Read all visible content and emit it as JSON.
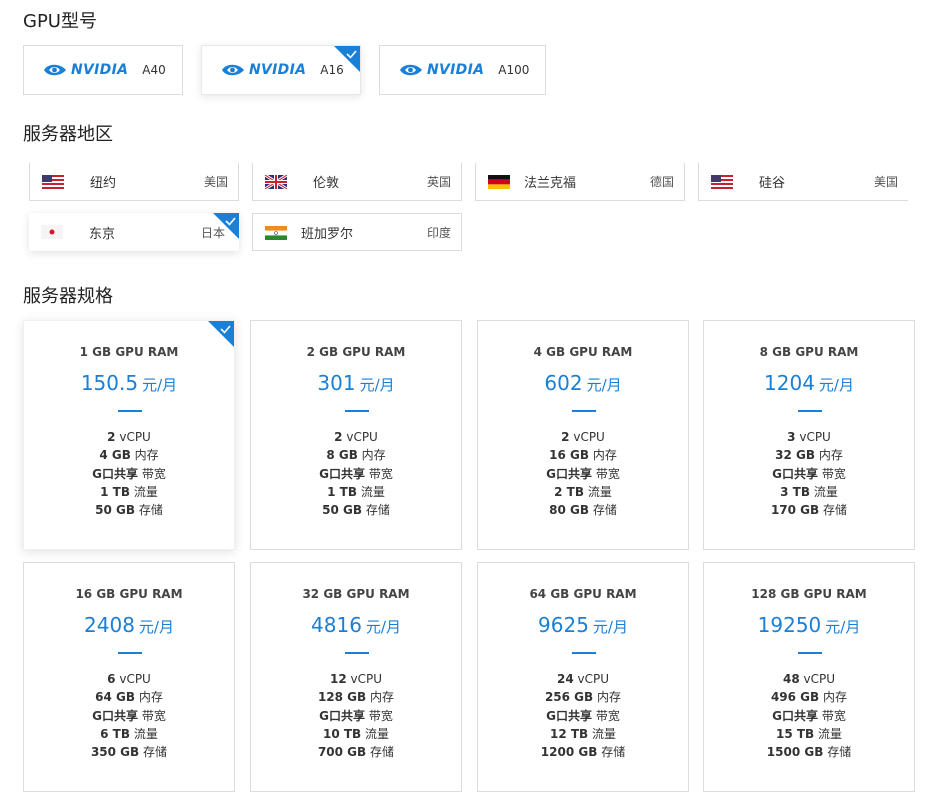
{
  "sections": {
    "gpu_title": "GPU型号",
    "region_title": "服务器地区",
    "spec_title": "服务器规格"
  },
  "brand": {
    "name": "NVIDIA",
    "color": "#1a7fd6"
  },
  "gpu_models": [
    {
      "model": "A40",
      "selected": false
    },
    {
      "model": "A16",
      "selected": true
    },
    {
      "model": "A100",
      "selected": false
    }
  ],
  "regions": [
    {
      "city": "纽约",
      "country": "美国",
      "flag": "us-flag-icon",
      "selected": false
    },
    {
      "city": "伦敦",
      "country": "英国",
      "flag": "uk-flag-icon",
      "selected": false
    },
    {
      "city": "法兰克福",
      "country": "德国",
      "flag": "de-flag-icon",
      "selected": false
    },
    {
      "city": "硅谷",
      "country": "美国",
      "flag": "us-flag-icon",
      "selected": false
    },
    {
      "city": "东京",
      "country": "日本",
      "flag": "jp-flag-icon",
      "selected": true
    },
    {
      "city": "班加罗尔",
      "country": "印度",
      "flag": "in-flag-icon",
      "selected": false
    }
  ],
  "price_unit": "元/月",
  "specs": [
    {
      "ram": "1 GB GPU RAM",
      "price": "150.5",
      "vcpu_n": "2",
      "vcpu_l": "vCPU",
      "mem_n": "4 GB",
      "mem_l": "内存",
      "bw_n": "G口共享",
      "bw_l": "带宽",
      "traffic_n": "1 TB",
      "traffic_l": "流量",
      "storage_n": "50 GB",
      "storage_l": "存储",
      "selected": true
    },
    {
      "ram": "2 GB GPU RAM",
      "price": "301",
      "vcpu_n": "2",
      "vcpu_l": "vCPU",
      "mem_n": "8 GB",
      "mem_l": "内存",
      "bw_n": "G口共享",
      "bw_l": "带宽",
      "traffic_n": "1 TB",
      "traffic_l": "流量",
      "storage_n": "50 GB",
      "storage_l": "存储",
      "selected": false
    },
    {
      "ram": "4 GB GPU RAM",
      "price": "602",
      "vcpu_n": "2",
      "vcpu_l": "vCPU",
      "mem_n": "16 GB",
      "mem_l": "内存",
      "bw_n": "G口共享",
      "bw_l": "带宽",
      "traffic_n": "2 TB",
      "traffic_l": "流量",
      "storage_n": "80 GB",
      "storage_l": "存储",
      "selected": false
    },
    {
      "ram": "8 GB GPU RAM",
      "price": "1204",
      "vcpu_n": "3",
      "vcpu_l": "vCPU",
      "mem_n": "32 GB",
      "mem_l": "内存",
      "bw_n": "G口共享",
      "bw_l": "带宽",
      "traffic_n": "3 TB",
      "traffic_l": "流量",
      "storage_n": "170 GB",
      "storage_l": "存储",
      "selected": false
    },
    {
      "ram": "16 GB GPU RAM",
      "price": "2408",
      "vcpu_n": "6",
      "vcpu_l": "vCPU",
      "mem_n": "64 GB",
      "mem_l": "内存",
      "bw_n": "G口共享",
      "bw_l": "带宽",
      "traffic_n": "6 TB",
      "traffic_l": "流量",
      "storage_n": "350 GB",
      "storage_l": "存储",
      "selected": false
    },
    {
      "ram": "32 GB GPU RAM",
      "price": "4816",
      "vcpu_n": "12",
      "vcpu_l": "vCPU",
      "mem_n": "128 GB",
      "mem_l": "内存",
      "bw_n": "G口共享",
      "bw_l": "带宽",
      "traffic_n": "10 TB",
      "traffic_l": "流量",
      "storage_n": "700 GB",
      "storage_l": "存储",
      "selected": false
    },
    {
      "ram": "64 GB GPU RAM",
      "price": "9625",
      "vcpu_n": "24",
      "vcpu_l": "vCPU",
      "mem_n": "256 GB",
      "mem_l": "内存",
      "bw_n": "G口共享",
      "bw_l": "带宽",
      "traffic_n": "12 TB",
      "traffic_l": "流量",
      "storage_n": "1200 GB",
      "storage_l": "存储",
      "selected": false
    },
    {
      "ram": "128 GB GPU RAM",
      "price": "19250",
      "vcpu_n": "48",
      "vcpu_l": "vCPU",
      "mem_n": "496 GB",
      "mem_l": "内存",
      "bw_n": "G口共享",
      "bw_l": "带宽",
      "traffic_n": "15 TB",
      "traffic_l": "流量",
      "storage_n": "1500 GB",
      "storage_l": "存储",
      "selected": false
    }
  ],
  "accent_color": "#1a7fd6"
}
